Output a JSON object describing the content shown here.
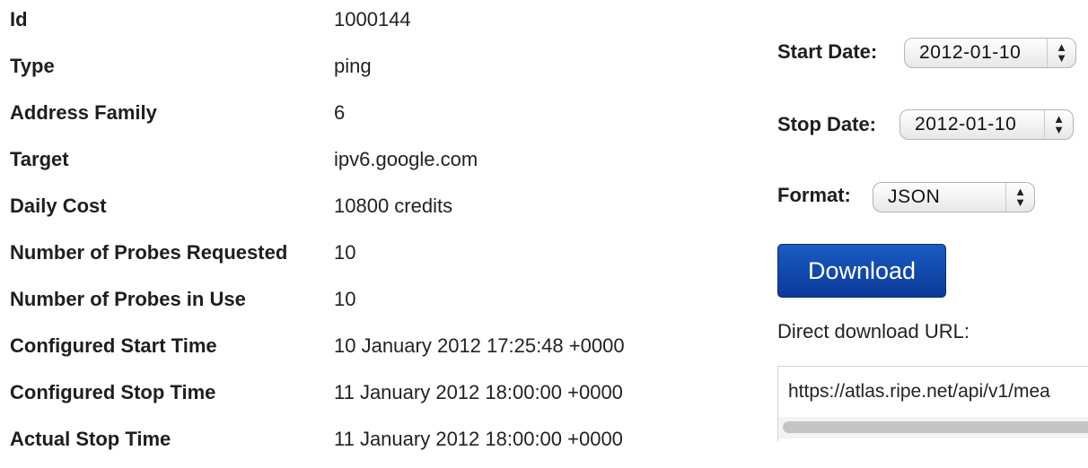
{
  "details": [
    {
      "label": "Id",
      "value": "1000144"
    },
    {
      "label": "Type",
      "value": "ping"
    },
    {
      "label": "Address Family",
      "value": "6"
    },
    {
      "label": "Target",
      "value": "ipv6.google.com"
    },
    {
      "label": "Daily Cost",
      "value": "10800 credits"
    },
    {
      "label": "Number of Probes Requested",
      "value": "10"
    },
    {
      "label": "Number of Probes in Use",
      "value": "10"
    },
    {
      "label": "Configured Start Time",
      "value": "10 January 2012 17:25:48 +0000"
    },
    {
      "label": "Configured Stop Time",
      "value": "11 January 2012 18:00:00 +0000"
    },
    {
      "label": "Actual Stop Time",
      "value": "11 January 2012 18:00:00 +0000"
    }
  ],
  "download": {
    "start_label": "Start Date:",
    "start_value": "2012-01-10",
    "stop_label": "Stop Date:",
    "stop_value": "2012-01-10",
    "format_label": "Format:",
    "format_value": "JSON",
    "button_label": "Download",
    "url_label": "Direct download URL:",
    "url_value": "https://atlas.ripe.net/api/v1/mea",
    "arrow_up": "▲",
    "arrow_down": "▼"
  },
  "colors": {
    "button_bg": "#0b3a98",
    "button_border": "#0a2d73",
    "label_text": "#1e1e1e",
    "scroll_thumb": "#c4c4c4"
  },
  "icons": {
    "select_arrows": "up-down-arrows-icon"
  }
}
